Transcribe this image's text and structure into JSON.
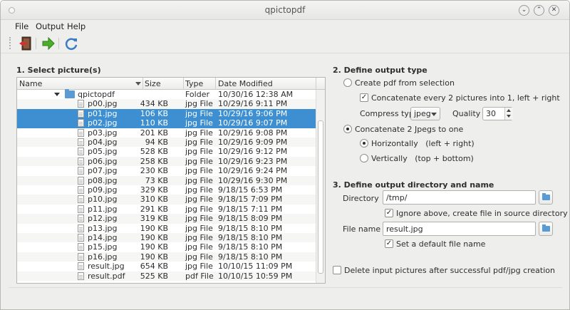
{
  "window": {
    "title": "qpictopdf",
    "controls": [
      "minimize",
      "maximize",
      "close"
    ]
  },
  "menu": {
    "file": "File",
    "output": "Output",
    "help": "Help"
  },
  "toolbar": {
    "exit_icon": "exit-icon",
    "run_icon": "arrow-right-icon",
    "refresh_icon": "refresh-icon"
  },
  "section1": {
    "title": "1. Select picture(s)"
  },
  "table": {
    "columns": {
      "name": "Name",
      "size": "Size",
      "type": "Type",
      "date": "Date Modified"
    },
    "folder": {
      "name": "qpictopdf",
      "size": "",
      "type": "Folder",
      "date": "10/30/16 12:38 AM"
    },
    "rows": [
      {
        "name": "p00.jpg",
        "size": "434 KB",
        "type": "jpg File",
        "date": "10/29/16 9:11 PM"
      },
      {
        "name": "p01.jpg",
        "size": "106 KB",
        "type": "jpg File",
        "date": "10/29/16 9:06 PM"
      },
      {
        "name": "p02.jpg",
        "size": "110 KB",
        "type": "jpg File",
        "date": "10/29/16 9:07 PM"
      },
      {
        "name": "p03.jpg",
        "size": "201 KB",
        "type": "jpg File",
        "date": "10/29/16 9:08 PM"
      },
      {
        "name": "p04.jpg",
        "size": "94 KB",
        "type": "jpg File",
        "date": "10/29/16 9:09 PM"
      },
      {
        "name": "p05.jpg",
        "size": "528 KB",
        "type": "jpg File",
        "date": "10/29/16 9:12 PM"
      },
      {
        "name": "p06.jpg",
        "size": "258 KB",
        "type": "jpg File",
        "date": "10/29/16 9:23 PM"
      },
      {
        "name": "p07.jpg",
        "size": "230 KB",
        "type": "jpg File",
        "date": "10/29/16 9:24 PM"
      },
      {
        "name": "p08.jpg",
        "size": "73 KB",
        "type": "jpg File",
        "date": "10/29/16 9:30 PM"
      },
      {
        "name": "p09.jpg",
        "size": "329 KB",
        "type": "jpg File",
        "date": "9/18/15 6:53 PM"
      },
      {
        "name": "p10.jpg",
        "size": "310 KB",
        "type": "jpg File",
        "date": "9/18/15 7:09 PM"
      },
      {
        "name": "p11.jpg",
        "size": "291 KB",
        "type": "jpg File",
        "date": "9/18/15 7:11 PM"
      },
      {
        "name": "p12.jpg",
        "size": "319 KB",
        "type": "jpg File",
        "date": "9/18/15 8:09 PM"
      },
      {
        "name": "p13.jpg",
        "size": "190 KB",
        "type": "jpg File",
        "date": "9/18/15 8:10 PM"
      },
      {
        "name": "p14.jpg",
        "size": "190 KB",
        "type": "jpg File",
        "date": "9/18/15 8:10 PM"
      },
      {
        "name": "p15.jpg",
        "size": "190 KB",
        "type": "jpg File",
        "date": "9/18/15 8:10 PM"
      },
      {
        "name": "p16.jpg",
        "size": "190 KB",
        "type": "jpg File",
        "date": "9/18/15 8:10 PM"
      },
      {
        "name": "result.jpg",
        "size": "654 KB",
        "type": "jpg File",
        "date": "10/10/15 11:09 PM"
      },
      {
        "name": "result.pdf",
        "size": "525 KB",
        "type": "pdf File",
        "date": "10/10/15 10:59 PM"
      }
    ],
    "selected": [
      "p01.jpg",
      "p02.jpg"
    ]
  },
  "section2": {
    "title": "2. Define output type",
    "create_pdf": "Create pdf from selection",
    "concat_every2": "Concatenate every 2 pictures into 1, left + right",
    "concat_every2_checked": true,
    "compress_label": "Compress type",
    "compress_value": "jpeg",
    "quality_label": "Quality",
    "quality_value": "30",
    "concat_jpegs": "Concatenate 2 Jpegs to one",
    "output_mode": "concat_jpegs",
    "horizontally": "Horizontally   (left + right)",
    "vertically": "Vertically   (top + bottom)",
    "orientation": "horizontally"
  },
  "section3": {
    "title": "3. Define output directory and name",
    "directory_label": "Directory",
    "directory_value": "/tmp/",
    "ignore_above": "Ignore above, create file in source directory",
    "ignore_above_checked": true,
    "filename_label": "File name",
    "filename_value": "result.jpg",
    "set_default": "Set a default file name",
    "set_default_checked": true
  },
  "delete_after": {
    "label": "Delete input pictures after successful pdf/jpg creation",
    "checked": false
  },
  "colors": {
    "selection": "#3d8fd1",
    "folder": "#5b9bd5",
    "window_bg": "#eeeeec"
  }
}
